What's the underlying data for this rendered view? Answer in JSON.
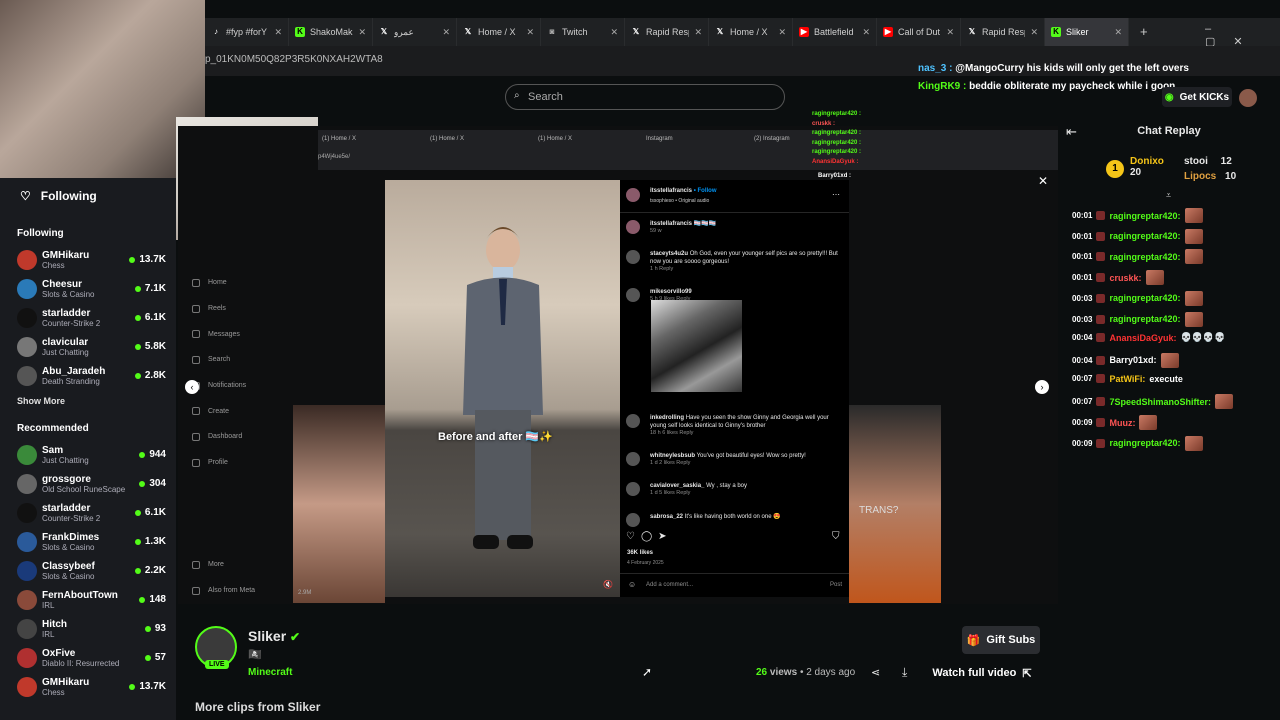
{
  "browser": {
    "tabs": [
      {
        "label": "#fyp #forY",
        "icon": "tiktok-icon",
        "color": "#ffffff"
      },
      {
        "label": "ShakoMak",
        "icon": "kick-icon",
        "color": "#53fc18"
      },
      {
        "label": "عمرو",
        "icon": "x-icon",
        "color": "#ffffff"
      },
      {
        "label": "Home / X",
        "icon": "x-icon",
        "color": "#ffffff"
      },
      {
        "label": "Twitch",
        "icon": "twitch-icon",
        "color": "#aaaaaa"
      },
      {
        "label": "Rapid Resp",
        "icon": "x-icon",
        "color": "#ffffff"
      },
      {
        "label": "Home / X",
        "icon": "x-icon",
        "color": "#ffffff"
      },
      {
        "label": "Battlefield",
        "icon": "youtube-icon",
        "color": "#ff0000"
      },
      {
        "label": "Call of Dut",
        "icon": "youtube-icon",
        "color": "#ff0000"
      },
      {
        "label": "Rapid Resp",
        "icon": "x-icon",
        "color": "#ffffff"
      },
      {
        "label": "Sliker",
        "icon": "kick-icon",
        "color": "#53fc18"
      }
    ],
    "url_fragment": "p_01KN0M50Q82P3R5K0NXAH2WTA8"
  },
  "search": {
    "placeholder": "Search"
  },
  "stream_chat": [
    {
      "user": "nas_3 :",
      "text": "@MangoCurry his kids will only get the left overs",
      "color": "#4fc3ff"
    },
    {
      "user": "KingRK9 :",
      "text": "beddie obliterate my paycheck while i goon",
      "color": "#53fc18"
    }
  ],
  "get_kicks": "Get KICKs",
  "sidebar": {
    "header": "Following",
    "following_title": "Following",
    "following": [
      {
        "name": "GMHikaru",
        "cat": "Chess",
        "views": "13.7K",
        "color": "#c0392b"
      },
      {
        "name": "Cheesur",
        "cat": "Slots & Casino",
        "views": "7.1K",
        "color": "#2a7ab8"
      },
      {
        "name": "starladder",
        "cat": "Counter-Strike 2",
        "views": "6.1K",
        "color": "#111111"
      },
      {
        "name": "clavicular",
        "cat": "Just Chatting",
        "views": "5.8K",
        "color": "#777777"
      },
      {
        "name": "Abu_Jaradeh",
        "cat": "Death Stranding",
        "views": "2.8K",
        "color": "#555555"
      }
    ],
    "show_more": "Show More",
    "recommended_title": "Recommended",
    "recommended": [
      {
        "name": "Sam",
        "cat": "Just Chatting",
        "views": "944",
        "color": "#3a8a3a"
      },
      {
        "name": "grossgore",
        "cat": "Old School RuneScape",
        "views": "304",
        "color": "#666666"
      },
      {
        "name": "starladder",
        "cat": "Counter-Strike 2",
        "views": "6.1K",
        "color": "#111111"
      },
      {
        "name": "FrankDimes",
        "cat": "Slots & Casino",
        "views": "1.3K",
        "color": "#2a5a9a"
      },
      {
        "name": "Classybeef",
        "cat": "Slots & Casino",
        "views": "2.2K",
        "color": "#1a3a7a"
      },
      {
        "name": "FernAboutTown",
        "cat": "IRL",
        "views": "148",
        "color": "#8a4a3a"
      },
      {
        "name": "Hitch",
        "cat": "IRL",
        "views": "93",
        "color": "#444444"
      },
      {
        "name": "OxFive",
        "cat": "Diablo II: Resurrected",
        "views": "57",
        "color": "#b03030"
      },
      {
        "name": "GMHikaru",
        "cat": "Chess",
        "views": "13.7K",
        "color": "#c0392b"
      }
    ]
  },
  "inner_tabs": [
    "(1) Home / X",
    "(1) Home / X",
    "(1) Home / X",
    "Instagram",
    "(2) Instagram"
  ],
  "inner_url": "p4Wj4ue5e/",
  "ig_nav": [
    "Home",
    "Reels",
    "Messages",
    "Search",
    "Notifications",
    "Create",
    "Dashboard",
    "Profile"
  ],
  "ig_more": [
    "More",
    "Also from Meta"
  ],
  "post": {
    "author": "itsstellafrancis",
    "follow": "Follow",
    "audio": "tssophieso • Original audio",
    "caption_author": "itsstellafrancis",
    "caption_emoji": "🏳️‍⚧️🏳️‍⚧️🏳️‍⚧️",
    "caption_time": "59 w",
    "overlay_text": "Before and after 🏳️‍⚧️✨",
    "likes": "36K likes",
    "date": "4 February 2025",
    "add_comment": "Add a comment...",
    "post_btn": "Post",
    "views_overlay": "2.9M"
  },
  "comments": [
    {
      "user": "staceyts4u2u",
      "text": "Oh God, even your younger self pics are so pretty!!! But now you are soooo gorgeous!",
      "meta": "1 h   Reply"
    },
    {
      "user": "mikesorvillo99",
      "text": "",
      "meta": "5 h   9 likes   Reply"
    },
    {
      "user": "inkedrolling",
      "text": "Have you seen the show Ginny and Georgia well your young self looks identical to Ginny's brother",
      "meta": "18 h   6 likes   Reply"
    },
    {
      "user": "whitneylesbsub",
      "text": "You've got beautiful eyes! Wow so pretty!",
      "meta": "1 d   2 likes   Reply"
    },
    {
      "user": "cavialover_saskia_",
      "text": "Wy , stay a boy",
      "meta": "1 d   5 likes   Reply"
    },
    {
      "user": "sabrosa_22",
      "text": "It's like having both world on one 😍",
      "meta": ""
    }
  ],
  "right_thumb_text": "TRANS?",
  "overlay_chat": [
    {
      "user": "ragingreptar420 :",
      "color": "#53fc18"
    },
    {
      "user": "cruskk :",
      "color": "#ff5555"
    },
    {
      "user": "ragingreptar420 :",
      "color": "#53fc18"
    },
    {
      "user": "ragingreptar420 :",
      "color": "#53fc18"
    },
    {
      "user": "ragingreptar420 :",
      "color": "#53fc18"
    },
    {
      "user": "AnansiDaGyuk :",
      "color": "#ff3333"
    },
    {
      "user": "Barry01xd :",
      "color": "#ffffff"
    }
  ],
  "replay": {
    "title": "Chat Replay",
    "leaders": [
      {
        "name": "Donixo",
        "score": "20",
        "color": "#f5c518"
      },
      {
        "name": "stooi",
        "score": "12",
        "color": "#e0e0e0"
      },
      {
        "name": "Lipocs",
        "score": "10",
        "color": "#e0a040"
      }
    ],
    "rank": "1",
    "lines": [
      {
        "t": "00:01",
        "user": "ragingreptar420:",
        "color": "#53fc18",
        "msg": ""
      },
      {
        "t": "00:01",
        "user": "ragingreptar420:",
        "color": "#53fc18",
        "msg": ""
      },
      {
        "t": "00:01",
        "user": "ragingreptar420:",
        "color": "#53fc18",
        "msg": ""
      },
      {
        "t": "00:01",
        "user": "cruskk:",
        "color": "#ff5555",
        "msg": ""
      },
      {
        "t": "00:03",
        "user": "ragingreptar420:",
        "color": "#53fc18",
        "msg": ""
      },
      {
        "t": "00:03",
        "user": "ragingreptar420:",
        "color": "#53fc18",
        "msg": ""
      },
      {
        "t": "00:04",
        "user": "AnansiDaGyuk:",
        "color": "#ff3333",
        "msg": "💀💀💀💀"
      },
      {
        "t": "00:04",
        "user": "Barry01xd:",
        "color": "#ffffff",
        "msg": ""
      },
      {
        "t": "00:07",
        "user": "PatWiFi:",
        "color": "#f5c518",
        "msg": "execute"
      },
      {
        "t": "00:07",
        "user": "7SpeedShimanoShifter:",
        "color": "#53fc18",
        "msg": ""
      },
      {
        "t": "00:09",
        "user": "Muuz:",
        "color": "#ff5555",
        "msg": ""
      },
      {
        "t": "00:09",
        "user": "ragingreptar420:",
        "color": "#53fc18",
        "msg": ""
      }
    ]
  },
  "clip": {
    "channel": "Sliker",
    "live": "LIVE",
    "subtitle": "🏴‍☠️",
    "category": "Minecraft",
    "views_count": "26",
    "views_label": "views",
    "age": "• 2 days ago",
    "gift_subs": "Gift Subs",
    "watch_full": "Watch full video",
    "more_clips": "More clips from Sliker"
  },
  "colors": {
    "kick_green": "#53fc18",
    "bg": "#0b0e0f",
    "sidebar": "#191b1f"
  }
}
